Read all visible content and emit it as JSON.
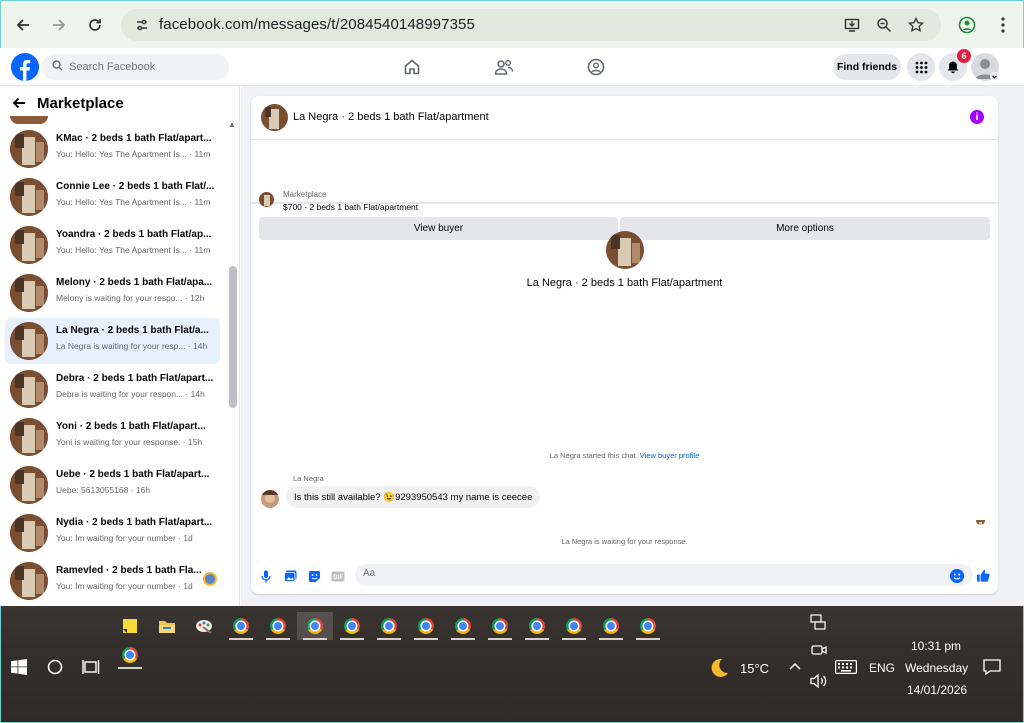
{
  "browser": {
    "url": "facebook.com/messages/t/2084540148997355"
  },
  "fb": {
    "search_placeholder": "Search Facebook",
    "find_friends": "Find friends",
    "notification_count": "6"
  },
  "sidebar": {
    "title": "Marketplace",
    "conversations": [
      {
        "name": "KMac · 2 beds 1 bath Flat/apart...",
        "preview": "You: Hello: Yes The Apartment Is... · 11m",
        "active": false
      },
      {
        "name": "Connie Lee · 2 beds 1 bath Flat/...",
        "preview": "You: Hello: Yes The Apartment Is... · 11m",
        "active": false
      },
      {
        "name": "Yoandra · 2 beds 1 bath Flat/ap...",
        "preview": "You: Hello: Yes The Apartment Is... · 11m",
        "active": false
      },
      {
        "name": "Melony · 2 beds 1 bath Flat/apa...",
        "preview": "Melony is waiting for your respo... · 12h",
        "active": false
      },
      {
        "name": "La Negra · 2 beds 1 bath Flat/a...",
        "preview": "La Negra is waiting for your resp... · 14h",
        "active": true
      },
      {
        "name": "Debra · 2 beds 1 bath Flat/apart...",
        "preview": "Debra is waiting for your respon... · 14h",
        "active": false
      },
      {
        "name": "Yoni · 2 beds 1 bath Flat/apart...",
        "preview": "Yoni is waiting for your response. · 15h",
        "active": false
      },
      {
        "name": "Uebe · 2 beds 1 bath Flat/apart...",
        "preview": "Uebe: 5613055168 · 16h",
        "active": false
      },
      {
        "name": "Nydia · 2 beds 1 bath Flat/apart...",
        "preview": "You: Im waiting for your number · 1d",
        "active": false
      },
      {
        "name": "Ramevled · 2 beds 1 bath Fla...",
        "preview": "You: Im waiting for your number · 1d",
        "active": false
      }
    ]
  },
  "chat": {
    "title": "La Negra · 2 beds 1 bath Flat/apartment",
    "marketplace_label": "Marketplace",
    "listing": "$700 - 2 beds 1 bath Flat/apartment",
    "view_buyer": "View buyer",
    "more_options": "More options",
    "started_text": "La Negra started this chat.",
    "view_buyer_profile": "View buyer profile",
    "sender": "La Negra",
    "message": "Is this still available? 😉9293950543 my name is ceecee",
    "waiting": "La Negra is waiting for your response.",
    "input_placeholder": "Aa"
  },
  "taskbar": {
    "temperature": "15°C",
    "language": "ENG",
    "time": "10:31 pm",
    "day": "Wednesday",
    "date": "14/01/2026"
  },
  "colors": {
    "fb_blue": "#0866ff",
    "active_row": "#e7f0fd",
    "info_purple": "#a300ff",
    "badge_red": "#e41e3f"
  }
}
